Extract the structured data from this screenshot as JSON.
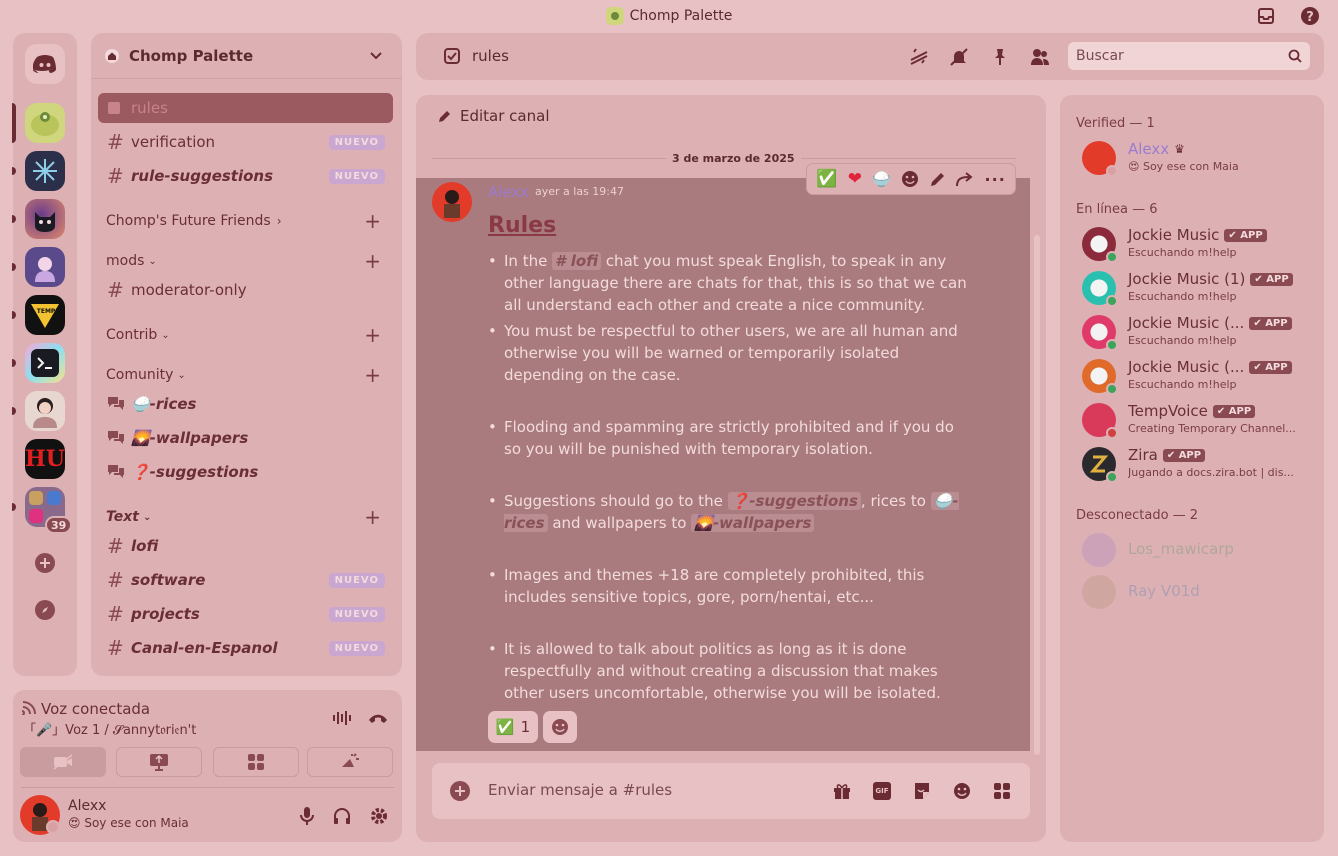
{
  "window": {
    "title": "Chomp Palette"
  },
  "server_rail": {
    "unread_badge": "39"
  },
  "guild": {
    "name": "Chomp Palette",
    "channels_top": [
      {
        "name": "rules",
        "selected": true
      },
      {
        "name": "verification",
        "badge": "NUEVO"
      },
      {
        "name": "rule-suggestions",
        "badge": "NUEVO"
      }
    ],
    "categories": {
      "future": "Chomp's Future Friends",
      "mods": "mods",
      "contrib": "Contrib",
      "comunity": "Comunity",
      "text": "Text"
    },
    "mods_channels": [
      "moderator-only"
    ],
    "comunity_channels": [
      "🍚-rices",
      "🌄-wallpapers",
      "❓-suggestions"
    ],
    "text_channels": [
      {
        "name": "lofi"
      },
      {
        "name": "software",
        "badge": "NUEVO"
      },
      {
        "name": "projects",
        "badge": "NUEVO"
      },
      {
        "name": "Canal-en-Espanol",
        "badge": "NUEVO"
      }
    ]
  },
  "voice": {
    "status": "Voz conectada",
    "channel": "「🎤」Voz 1 / 𝓢annyt𝔬ri𝔢n't"
  },
  "user": {
    "name": "Alexx",
    "status": "😍 Soy ese con Maia"
  },
  "header": {
    "channel": "rules",
    "search_placeholder": "Buscar"
  },
  "chat": {
    "edit_channel": "Editar canal",
    "date_divider": "3 de marzo de 2025",
    "author": "Alexx",
    "timestamp": "ayer a las 19:47",
    "heading": "Rules",
    "rules": {
      "r1_pre": "In the",
      "r1_mention": "# lofi",
      "r1_post": "chat you must speak English, to speak in any other language there are chats for that, this is so that we can all understand each other and create a nice community.",
      "r2": "You must be respectful to other users, we are all human and otherwise you will be warned or temporarily isolated depending on the case.",
      "r3": "Flooding and spamming are strictly prohibited and if you do so you will be punished with temporary isolation.",
      "r4_a": "Suggestions should go to the",
      "r4_m1": "❓-suggestions",
      "r4_b": ", rices to",
      "r4_m2": "🍚-rices",
      "r4_c": "and wallpapers to",
      "r4_m3": "🌄-wallpapers",
      "r5": "Images and themes +18 are completely prohibited, this includes sensitive topics, gore, porn/hentai, etc...",
      "r6": "It is allowed to talk about politics as long as it is done respectfully and without creating a discussion that makes other users uncomfortable, otherwise you will be isolated."
    },
    "reaction": {
      "emoji": "✅",
      "count": "1"
    },
    "composer_placeholder": "Enviar mensaje a #rules"
  },
  "members": {
    "verified_header": "Verified — 1",
    "online_header": "En línea — 6",
    "offline_header": "Desconectado — 2",
    "verified": [
      {
        "name": "Alexx",
        "activity": "😍 Soy ese con Maia"
      }
    ],
    "online": [
      {
        "name": "Jockie Music",
        "activity": "Escuchando m!help",
        "tag": "APP"
      },
      {
        "name": "Jockie Music (1)",
        "activity": "Escuchando m!help",
        "tag": "APP"
      },
      {
        "name": "Jockie Music (...",
        "activity": "Escuchando m!help",
        "tag": "APP"
      },
      {
        "name": "Jockie Music (...",
        "activity": "Escuchando m!help",
        "tag": "APP"
      },
      {
        "name": "TempVoice",
        "activity": "Creating Temporary Channel...",
        "tag": "APP"
      },
      {
        "name": "Zira",
        "activity": "Jugando a docs.zira.bot | dis...",
        "tag": "APP"
      }
    ],
    "offline": [
      {
        "name": "Los_mawicarp"
      },
      {
        "name": "Ray V01d"
      }
    ]
  },
  "colors": {
    "background": "#e7c1c4",
    "panel": "#ddb1b4",
    "accent": "#6a2b33",
    "online": "#3ba55c",
    "badge_new": "#c9a7d0"
  }
}
